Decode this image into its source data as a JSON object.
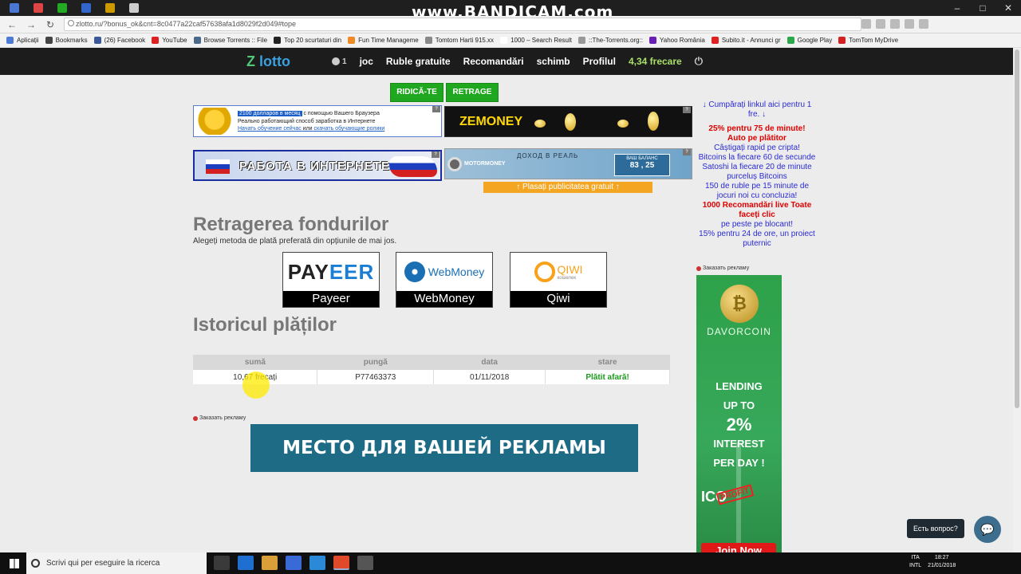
{
  "browser": {
    "tabstrip_text": "www.BANDICAM.com",
    "url": "zlotto.ru/?bonus_ok&cnt=8c0477a22caf57638afa1d8029f2d049#tope",
    "bookmarks": [
      {
        "label": "Aplicații",
        "color": "#4d7bd6"
      },
      {
        "label": "Bookmarks",
        "color": "#444444"
      },
      {
        "label": "(26) Facebook",
        "color": "#3b5998"
      },
      {
        "label": "YouTube",
        "color": "#e02020"
      },
      {
        "label": "Browse Torrents :: File",
        "color": "#4a6a8a"
      },
      {
        "label": "Top 20 scurtaturi din",
        "color": "#222222"
      },
      {
        "label": "Fun Time Manageme",
        "color": "#f08a24"
      },
      {
        "label": "Tomtom Harti 915.xx",
        "color": "#888888"
      },
      {
        "label": "1000 – Search Result",
        "color": "#ffffff"
      },
      {
        "label": "::The-Torrents.org::",
        "color": "#999999"
      },
      {
        "label": "Yahoo România",
        "color": "#6a1fb4"
      },
      {
        "label": "Subito.it - Annunci gr",
        "color": "#e02020"
      },
      {
        "label": "Google Play",
        "color": "#2aa84a"
      },
      {
        "label": "TomTom MyDrive",
        "color": "#d42020"
      }
    ]
  },
  "site": {
    "logo_z": "Z",
    "logo_text": "lotto",
    "user_count": "1",
    "nav": [
      "joc",
      "Ruble gratuite",
      "Recomandări",
      "schimb",
      "Profilul"
    ],
    "balance": "4,34 frecare",
    "power_icon": "⏻"
  },
  "actions": {
    "deposit": "RIDICĂ-TE",
    "withdraw": "RETRAGE"
  },
  "ads": {
    "ad1_highlight": "2100 долларов в месяц",
    "ad1_rest": "с помощью Вашего Браузера",
    "ad1_line2": "Реально работающий способ заработка в Интернете",
    "ad1_line3": "Начать обучение сейчас",
    "ad1_line3_mid": "или",
    "ad1_line3_link2": "скачать обучающие ролики",
    "ad2_text": "ZEMONEY",
    "ad3_text": "РАБОТА В ИНТЕРНЕТЕ",
    "ad4_brand": "MOTORMONEY",
    "ad4_sub": "ДОХОД В РЕАЛЬ",
    "ad4_balance_label": "ВАШ БАЛАНС",
    "ad4_balance_value": "83 , 25",
    "question_mark": "?",
    "promo": "↑ Plasați publicitatea gratuit ↑",
    "order_ad": "Заказать рекламу",
    "big_banner": "МЕСТО ДЛЯ ВАШЕЙ РЕКЛАМЫ"
  },
  "withdraw_section": {
    "title": "Retragerea fondurilor",
    "subtitle": "Alegeți metoda de plată preferată din opțiunile de mai jos.",
    "methods": [
      {
        "logo": "PAY",
        "logo_accent": "EER",
        "name": "Payeer"
      },
      {
        "logo": "WebMoney",
        "name": "WebMoney"
      },
      {
        "logo": "QIWI",
        "logo_sub": "кошелек",
        "name": "Qiwi"
      }
    ]
  },
  "history": {
    "title": "Istoricul plăților",
    "columns": [
      "sumă",
      "pungă",
      "data",
      "stare"
    ],
    "rows": [
      {
        "amount": "10,67 frecați",
        "wallet": "P77463373",
        "date": "01/11/2018",
        "status": "Plătit afară!"
      }
    ]
  },
  "right_column": {
    "links": [
      {
        "text": "↓ Cumpărați linkul aici pentru 1 fre. ↓",
        "style": "blue"
      },
      {
        "text": "25% pentru 75 de minute!",
        "style": "red"
      },
      {
        "text": "Auto pe plătitor",
        "style": "red"
      },
      {
        "text": "Câștigați rapid pe cripta!",
        "style": "blue"
      },
      {
        "text": "Bitcoins la fiecare 60 de secunde",
        "style": "blue"
      },
      {
        "text": "Satoshi la fiecare 20 de minute purceluș Bitcoins",
        "style": "blue"
      },
      {
        "text": "150 de ruble pe 15 minute de jocuri noi cu concluzia!",
        "style": "blue"
      },
      {
        "text": "1000 Recomandări live Toate faceți clic",
        "style": "red"
      },
      {
        "text": "pe peste pe blocant!",
        "style": "blue"
      },
      {
        "text": "15% pentru 24 de ore, un proiect puternic",
        "style": "blue"
      }
    ],
    "sky_coin": "₿",
    "sky_brand": "DAVORCOIN",
    "sky_line1": "LENDING",
    "sky_line2": "UP TO",
    "sky_line3": "2%",
    "sky_line4": "INTEREST",
    "sky_line5": "PER DAY !",
    "sky_ico": "ICO",
    "sky_stamp": "PROFIT",
    "sky_join": "Join Now"
  },
  "chat": {
    "label": "Есть вопрос?",
    "icon": "chat-icon"
  },
  "taskbar": {
    "search_placeholder": "Scrivi qui per eseguire la ricerca",
    "lang": "ITA",
    "layout": "INTL",
    "time": "18:27",
    "date": "21/01/2018"
  }
}
